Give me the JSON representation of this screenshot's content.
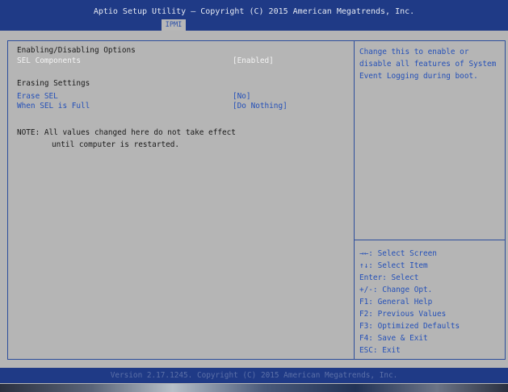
{
  "header": {
    "title": "Aptio Setup Utility – Copyright (C) 2015 American Megatrends, Inc.",
    "active_tab": "IPMI"
  },
  "main": {
    "section1_heading": "Enabling/Disabling Options",
    "sel_components": {
      "label": "SEL Components",
      "value": "[Enabled]"
    },
    "section2_heading": "Erasing Settings",
    "erase_sel": {
      "label": "Erase SEL",
      "value": "[No]"
    },
    "when_sel_full": {
      "label": "When SEL is Full",
      "value": "[Do Nothing]"
    },
    "note_line1": "NOTE: All values changed here do not take effect",
    "note_line2": "until computer is restarted."
  },
  "help": {
    "text": "Change this to enable or disable all features of System Event Logging during boot."
  },
  "keys": [
    "→←: Select Screen",
    "↑↓: Select Item",
    "Enter: Select",
    "+/-: Change Opt.",
    "F1: General Help",
    "F2: Previous Values",
    "F3: Optimized Defaults",
    "F4: Save & Exit",
    "ESC: Exit"
  ],
  "footer": {
    "version": "Version 2.17.1245. Copyright (C) 2015 American Megatrends, Inc."
  }
}
